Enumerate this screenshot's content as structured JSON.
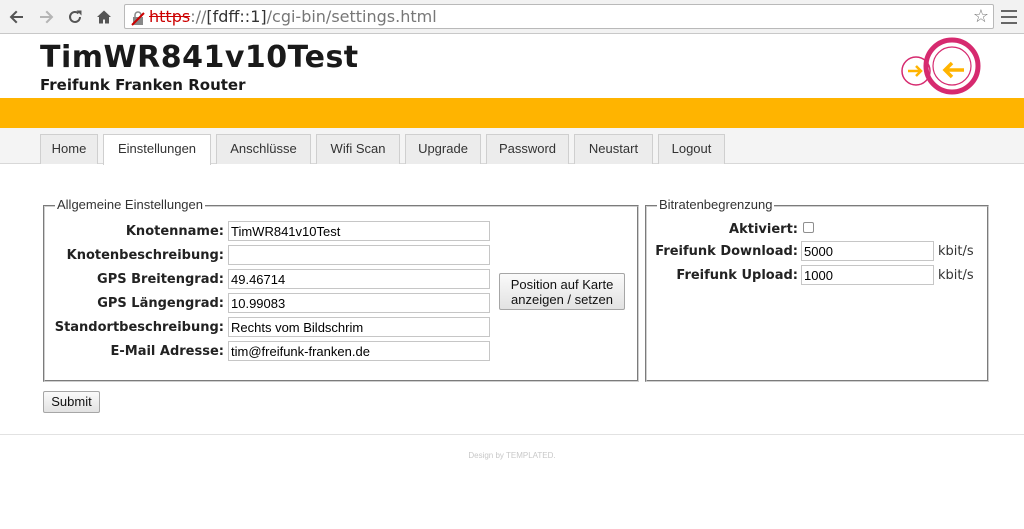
{
  "browser": {
    "url_protocol": "https",
    "url_separator": "://",
    "url_host": "[fdff::1]",
    "url_path": "/cgi-bin/settings.html",
    "back_icon": "arrow-left",
    "forward_icon": "arrow-right",
    "reload_icon": "reload",
    "home_icon": "home",
    "bookmark_icon": "star"
  },
  "header": {
    "title": "TimWR841v10Test",
    "subtitle": "Freifunk Franken Router",
    "accent_color": "#ffb400",
    "logo_color": "#d62a6f"
  },
  "tabs": [
    {
      "label": "Home"
    },
    {
      "label": "Einstellungen",
      "active": true
    },
    {
      "label": "Anschlüsse"
    },
    {
      "label": "Wifi Scan"
    },
    {
      "label": "Upgrade"
    },
    {
      "label": "Password"
    },
    {
      "label": "Neustart"
    },
    {
      "label": "Logout"
    }
  ],
  "general": {
    "legend": "Allgemeine Einstellungen",
    "name_label": "Knotenname:",
    "name_value": "TimWR841v10Test",
    "desc_label": "Knotenbeschreibung:",
    "desc_value": "",
    "lat_label": "GPS Breitengrad:",
    "lat_value": "49.46714",
    "lon_label": "GPS Längengrad:",
    "lon_value": "10.99083",
    "location_label": "Standortbeschreibung:",
    "location_value": "Rechts vom Bildschrim",
    "email_label": "E-Mail Adresse:",
    "email_value": "tim@freifunk-franken.de",
    "map_button_line1": "Position auf Karte",
    "map_button_line2": "anzeigen / setzen"
  },
  "bitrate": {
    "legend": "Bitratenbegrenzung",
    "enabled_label": "Aktiviert:",
    "enabled": false,
    "download_label": "Freifunk Download:",
    "download_value": "5000",
    "download_unit": "kbit/s",
    "upload_label": "Freifunk Upload:",
    "upload_value": "1000",
    "upload_unit": "kbit/s"
  },
  "submit_label": "Submit",
  "footer": {
    "credits": "Design by TEMPLATED."
  }
}
